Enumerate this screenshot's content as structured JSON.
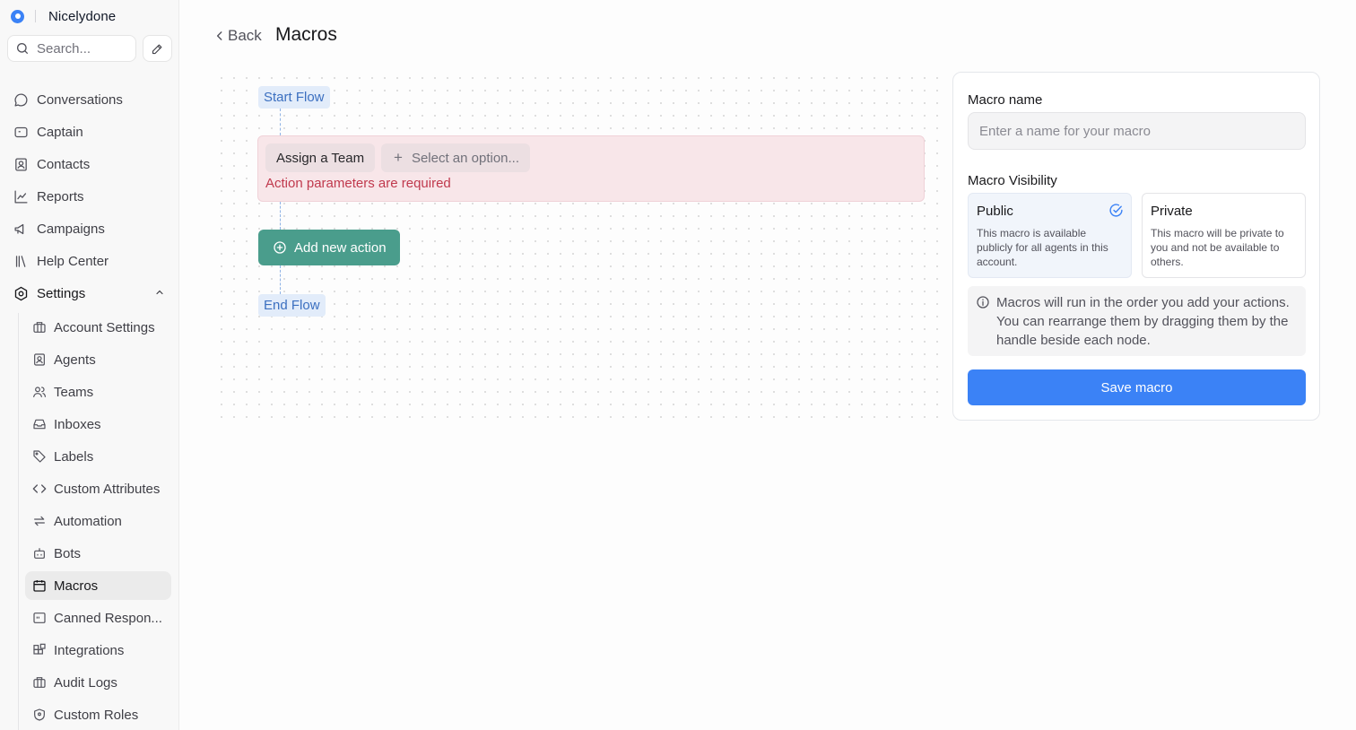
{
  "brand": {
    "name": "Nicelydone"
  },
  "search": {
    "placeholder": "Search..."
  },
  "nav": {
    "items": [
      {
        "label": "Conversations",
        "icon": "chat-bubble-icon"
      },
      {
        "label": "Captain",
        "icon": "captain-icon"
      },
      {
        "label": "Contacts",
        "icon": "contact-card-icon"
      },
      {
        "label": "Reports",
        "icon": "chart-line-icon"
      },
      {
        "label": "Campaigns",
        "icon": "megaphone-icon"
      },
      {
        "label": "Help Center",
        "icon": "library-icon"
      }
    ],
    "settings": {
      "label": "Settings",
      "icon": "gear-icon"
    },
    "settings_items": [
      {
        "label": "Account Settings",
        "icon": "briefcase-icon"
      },
      {
        "label": "Agents",
        "icon": "contact-card-icon"
      },
      {
        "label": "Teams",
        "icon": "users-icon"
      },
      {
        "label": "Inboxes",
        "icon": "inbox-icon"
      },
      {
        "label": "Labels",
        "icon": "tag-icon"
      },
      {
        "label": "Custom Attributes",
        "icon": "code-icon"
      },
      {
        "label": "Automation",
        "icon": "arrows-swap-icon"
      },
      {
        "label": "Bots",
        "icon": "bot-icon"
      },
      {
        "label": "Macros",
        "icon": "calendar-icon",
        "active": true
      },
      {
        "label": "Canned Respon...",
        "icon": "canned-response-icon"
      },
      {
        "label": "Integrations",
        "icon": "blocks-icon"
      },
      {
        "label": "Audit Logs",
        "icon": "briefcase-icon"
      },
      {
        "label": "Custom Roles",
        "icon": "shield-icon"
      }
    ]
  },
  "header": {
    "back_label": "Back",
    "title": "Macros"
  },
  "flow": {
    "start_label": "Start Flow",
    "action": {
      "type_label": "Assign a Team",
      "select_placeholder": "Select an option...",
      "error": "Action parameters are required"
    },
    "add_action_label": "Add new action",
    "end_label": "End Flow"
  },
  "panel": {
    "name_label": "Macro name",
    "name_placeholder": "Enter a name for your macro",
    "name_value": "",
    "visibility_label": "Macro Visibility",
    "public": {
      "title": "Public",
      "description": "This macro is available publicly for all agents in this account.",
      "selected": true
    },
    "private": {
      "title": "Private",
      "description": "This macro will be private to you and not be available to others.",
      "selected": false
    },
    "info": "Macros will run in the order you add your actions. You can rearrange them by dragging them by the handle beside each node.",
    "save_label": "Save macro"
  },
  "colors": {
    "accent": "#3b82f6",
    "add_action": "#4a9d8c",
    "error": "#c0394d",
    "active_nav": "#ebebeb"
  }
}
